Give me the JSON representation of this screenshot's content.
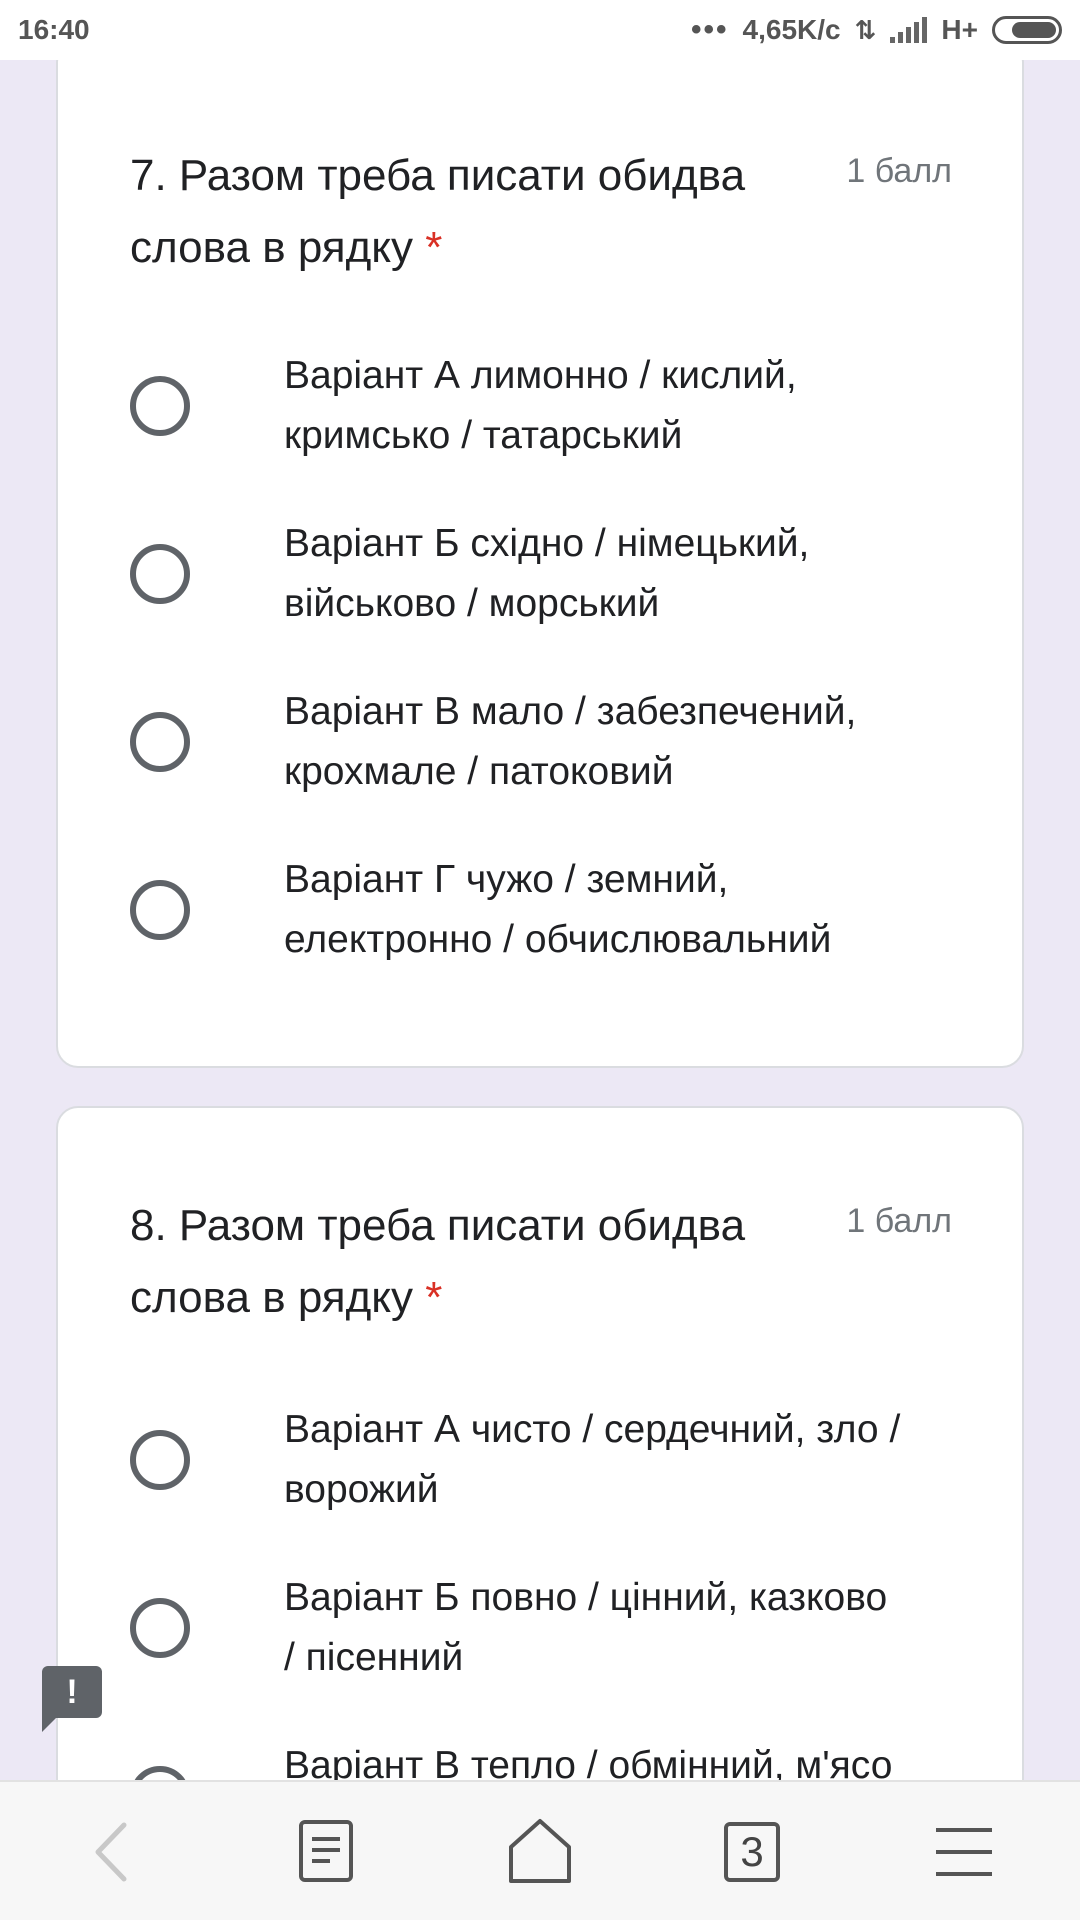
{
  "status_bar": {
    "time": "16:40",
    "dots": "•••",
    "speed": "4,65K/c",
    "network": "H+"
  },
  "questions": [
    {
      "number_title": "7. Разом треба писати обидва",
      "title_line2": "слова в рядку",
      "required_mark": "*",
      "points": "1 балл",
      "options": [
        {
          "line1": "Варіант А лимонно / кислий,",
          "line2": "кримсько / татарський"
        },
        {
          "line1": "Варіант Б східно / німецький,",
          "line2": "військово / морський"
        },
        {
          "line1": "Варіант В мало / забезпечений,",
          "line2": "крохмале / патоковий"
        },
        {
          "line1": "Варіант Г чужо / земний,",
          "line2": "електронно / обчислювальний"
        }
      ]
    },
    {
      "number_title": "8. Разом треба писати обидва",
      "title_line2": "слова в рядку",
      "required_mark": "*",
      "points": "1 балл",
      "options": [
        {
          "line1": "Варіант А чисто / сердечний, зло /",
          "line2": "ворожий"
        },
        {
          "line1": "Варіант Б повно / цінний, казково",
          "line2": "/ пісенний"
        },
        {
          "line1": "Варіант В тепло / обмінний, м'ясо",
          "line2": ""
        }
      ]
    }
  ],
  "feedback_button": {
    "glyph": "!"
  },
  "bottom_bar": {
    "tab_count": "3",
    "icons": [
      "back-icon",
      "bookmarks-icon",
      "home-icon",
      "tabs-icon",
      "menu-icon"
    ]
  }
}
